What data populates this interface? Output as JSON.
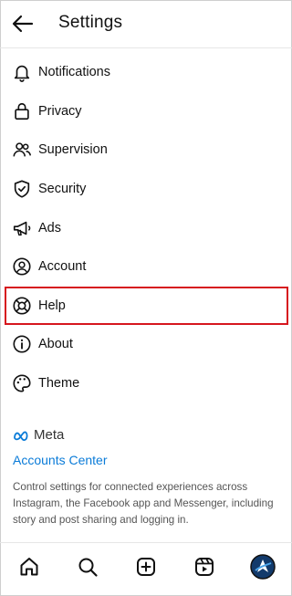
{
  "header": {
    "title": "Settings",
    "back_icon": "back-arrow-icon"
  },
  "menu": [
    {
      "label": "Notifications",
      "icon": "bell-icon"
    },
    {
      "label": "Privacy",
      "icon": "lock-icon"
    },
    {
      "label": "Supervision",
      "icon": "people-icon"
    },
    {
      "label": "Security",
      "icon": "shield-icon"
    },
    {
      "label": "Ads",
      "icon": "megaphone-icon"
    },
    {
      "label": "Account",
      "icon": "account-icon"
    },
    {
      "label": "Help",
      "icon": "lifebuoy-icon",
      "highlighted": true
    },
    {
      "label": "About",
      "icon": "info-icon"
    },
    {
      "label": "Theme",
      "icon": "palette-icon"
    }
  ],
  "meta": {
    "brand": "Meta",
    "accounts_center": "Accounts Center",
    "description": "Control settings for connected experiences across Instagram, the Facebook app and Messenger, including story and post sharing and logging in."
  },
  "tabbar": {
    "items": [
      "home-icon",
      "search-icon",
      "create-icon",
      "reels-icon",
      "profile-avatar"
    ]
  },
  "colors": {
    "highlight": "#d6161e",
    "link": "#0a7bd8",
    "meta_blue": "#0a7bd8"
  }
}
